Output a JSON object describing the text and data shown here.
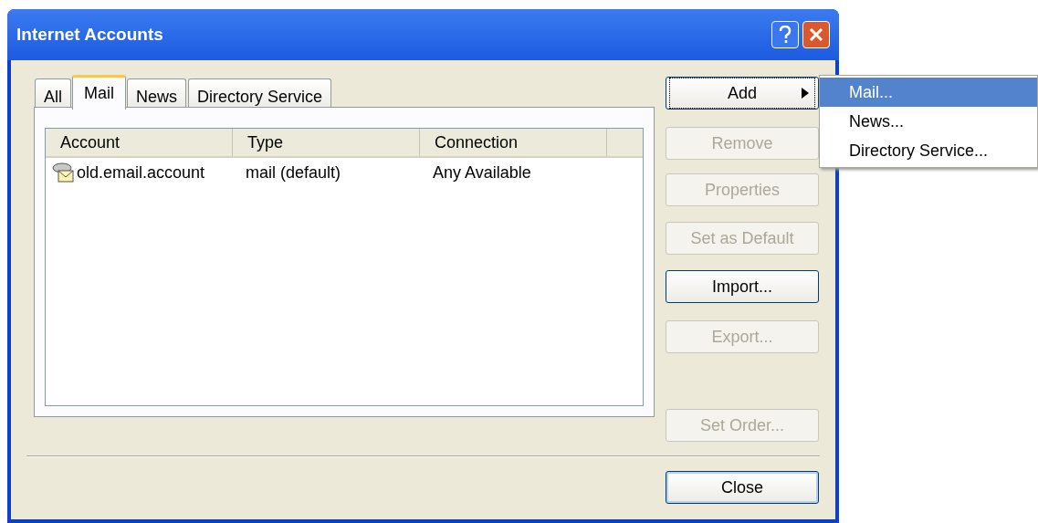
{
  "window": {
    "title": "Internet Accounts"
  },
  "tabs": [
    {
      "label": "All",
      "selected": false
    },
    {
      "label": "Mail",
      "selected": true
    },
    {
      "label": "News",
      "selected": false
    },
    {
      "label": "Directory Service",
      "selected": false
    }
  ],
  "table": {
    "columns": [
      "Account",
      "Type",
      "Connection"
    ],
    "rows": [
      {
        "cells": [
          "old.email.account",
          "mail (default)",
          "Any Available"
        ]
      }
    ]
  },
  "buttons": [
    {
      "label": "Add",
      "disabled": false,
      "focused": true,
      "submenu": true
    },
    {
      "label": "Remove",
      "disabled": true,
      "focused": false,
      "submenu": false
    },
    {
      "label": "Properties",
      "disabled": true,
      "focused": false,
      "submenu": false
    },
    {
      "label": "Set as Default",
      "disabled": true,
      "focused": false,
      "submenu": false
    },
    {
      "label": "Import...",
      "disabled": false,
      "focused": false,
      "submenu": false
    },
    {
      "label": "Export...",
      "disabled": true,
      "focused": false,
      "submenu": false
    },
    {
      "label": "Set Order...",
      "disabled": true,
      "focused": false,
      "submenu": false
    }
  ],
  "close_button": {
    "label": "Close"
  },
  "menu": [
    {
      "label": "Mail...",
      "selected": true
    },
    {
      "label": "News...",
      "selected": false
    },
    {
      "label": "Directory Service...",
      "selected": false
    }
  ]
}
